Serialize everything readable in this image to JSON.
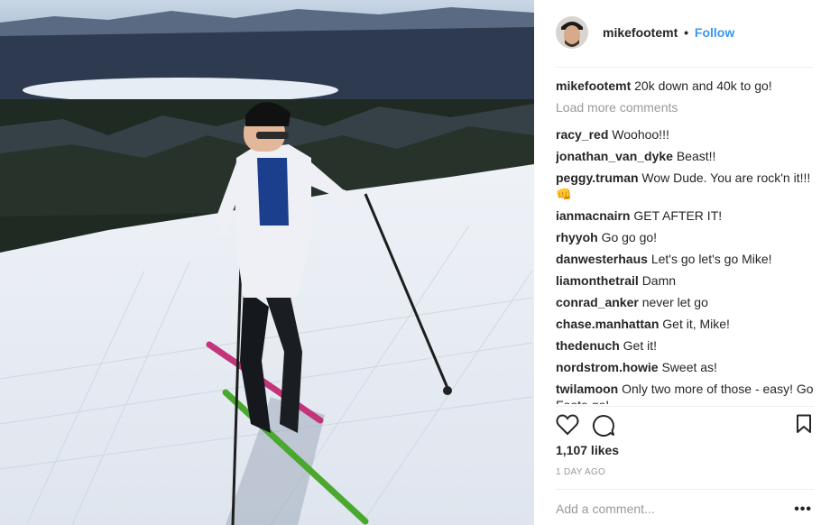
{
  "post": {
    "username": "mikefootemt",
    "separator": "•",
    "follow_label": "Follow"
  },
  "caption": {
    "username": "mikefootemt",
    "text": "20k down and 40k to go!"
  },
  "load_more_label": "Load more comments",
  "comments": [
    {
      "user": "racy_red",
      "text": "Woohoo!!!"
    },
    {
      "user": "jonathan_van_dyke",
      "text": "Beast!!"
    },
    {
      "user": "peggy.truman",
      "text": "Wow Dude. You are rock'n it!!! 👊"
    },
    {
      "user": "ianmacnairn",
      "text": "GET AFTER IT!"
    },
    {
      "user": "rhyyoh",
      "text": "Go go go!"
    },
    {
      "user": "danwesterhaus",
      "text": "Let's go let's go Mike!"
    },
    {
      "user": "liamonthetrail",
      "text": "Damn"
    },
    {
      "user": "conrad_anker",
      "text": "never let go"
    },
    {
      "user": "chase.manhattan",
      "text": "Get it, Mike!"
    },
    {
      "user": "thedenuch",
      "text": "Get it!"
    },
    {
      "user": "nordstrom.howie",
      "text": "Sweet as!"
    },
    {
      "user": "twilamoon",
      "text": "Only two more of those - easy! Go Foote go!"
    }
  ],
  "likes": "1,107 likes",
  "timestamp": "1 DAY AGO",
  "add_comment_placeholder": "Add a comment...",
  "more_options": "•••",
  "icons": {
    "like": "heart-icon",
    "comment": "comment-icon",
    "save": "bookmark-icon",
    "more": "more-options-icon"
  },
  "colors": {
    "accent": "#3897f0",
    "muted": "#999999",
    "text": "#262626"
  }
}
